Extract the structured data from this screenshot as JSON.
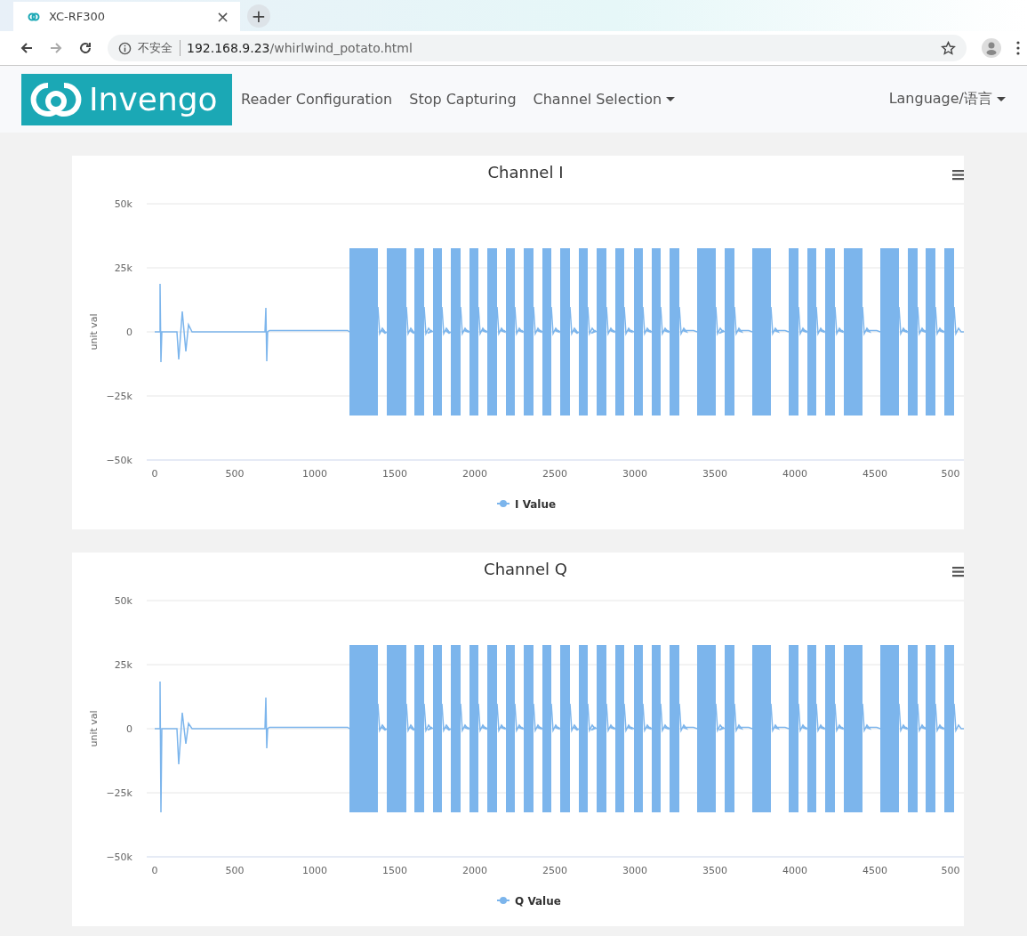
{
  "browser": {
    "tab_title": "XC-RF300",
    "close_glyph": "×",
    "new_tab_glyph": "+",
    "security_label": "不安全",
    "url_host": "192.168.9.23",
    "url_path": "/whirlwind_potato.html"
  },
  "navbar": {
    "brand": "Invengo",
    "items": [
      {
        "label": "Reader Configuration",
        "dropdown": false
      },
      {
        "label": "Stop Capturing",
        "dropdown": false
      },
      {
        "label": "Channel Selection",
        "dropdown": true
      }
    ],
    "language": {
      "label": "Language/语言",
      "dropdown": true
    }
  },
  "charts": [
    {
      "title": "Channel I",
      "y_axis_title": "unit val",
      "y_ticks": [
        "50k",
        "25k",
        "0",
        "−25k",
        "−50k"
      ],
      "x_ticks": [
        "0",
        "500",
        "1000",
        "1500",
        "2000",
        "2500",
        "3000",
        "3500",
        "4000",
        "4500",
        "500"
      ],
      "legend": "I Value"
    },
    {
      "title": "Channel Q",
      "y_axis_title": "unit val",
      "y_ticks": [
        "50k",
        "25k",
        "0",
        "−25k",
        "−50k"
      ],
      "x_ticks": [
        "0",
        "500",
        "1000",
        "1500",
        "2000",
        "2500",
        "3000",
        "3500",
        "4000",
        "4500",
        "500"
      ],
      "legend": "Q Value"
    }
  ]
}
